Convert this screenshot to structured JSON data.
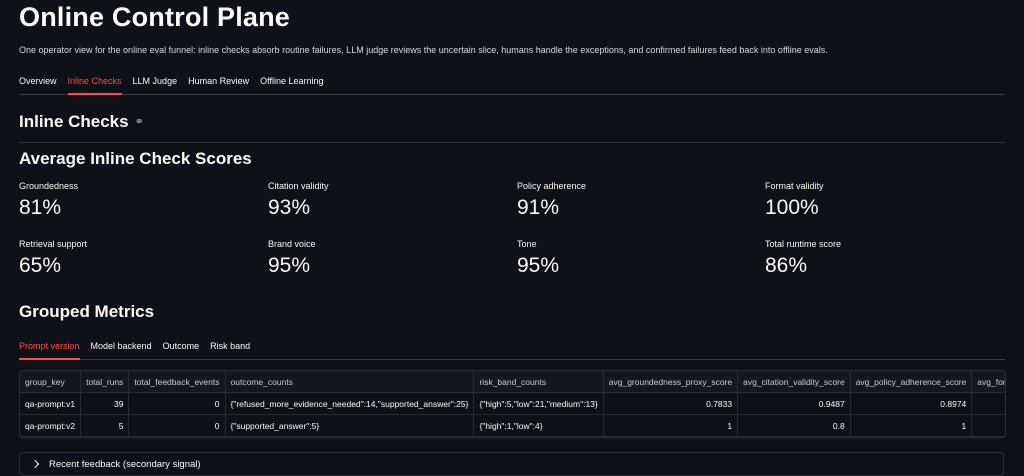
{
  "header": {
    "title": "Online Control Plane",
    "subtitle": "One operator view for the online eval funnel: inline checks absorb routine failures, LLM judge reviews the uncertain slice, humans handle the exceptions, and confirmed failures feed back into offline evals."
  },
  "main_tabs": [
    "Overview",
    "Inline Checks",
    "LLM Judge",
    "Human Review",
    "Offline Learning"
  ],
  "section": {
    "title": "Inline Checks",
    "link_icon": "link-icon"
  },
  "scores": {
    "title": "Average Inline Check Scores",
    "metrics": [
      {
        "label": "Groundedness",
        "value": "81%"
      },
      {
        "label": "Citation validity",
        "value": "93%"
      },
      {
        "label": "Policy adherence",
        "value": "91%"
      },
      {
        "label": "Format validity",
        "value": "100%"
      },
      {
        "label": "Retrieval support",
        "value": "65%"
      },
      {
        "label": "Brand voice",
        "value": "95%"
      },
      {
        "label": "Tone",
        "value": "95%"
      },
      {
        "label": "Total runtime score",
        "value": "86%"
      }
    ]
  },
  "grouped": {
    "title": "Grouped Metrics",
    "tabs": [
      "Prompt version",
      "Model backend",
      "Outcome",
      "Risk band"
    ],
    "table": {
      "columns": [
        "group_key",
        "total_runs",
        "total_feedback_events",
        "outcome_counts",
        "risk_band_counts",
        "avg_groundedness_proxy_score",
        "avg_citation_validity_score",
        "avg_policy_adherence_score",
        "avg_format_v"
      ],
      "rows": [
        [
          "qa-prompt:v1",
          "39",
          "0",
          "{\"refused_more_evidence_needed\":14,\"supported_answer\":25}",
          "{\"high\":5,\"low\":21,\"medium\":13}",
          "0.7833",
          "0.9487",
          "0.8974",
          ""
        ],
        [
          "qa-prompt:v2",
          "5",
          "0",
          "{\"supported_answer\":5}",
          "{\"high\":1,\"low\":4}",
          "1",
          "0.8",
          "1",
          ""
        ]
      ]
    }
  },
  "expander": {
    "label": "Recent feedback (secondary signal)"
  },
  "colors": {
    "background": "#0e1117",
    "accent": "#ff4b4b",
    "text": "#fafafa"
  }
}
